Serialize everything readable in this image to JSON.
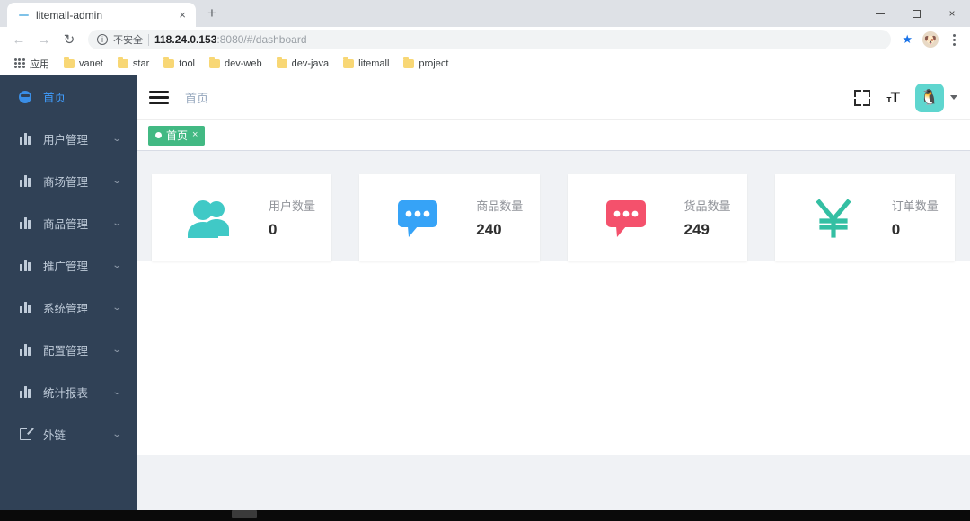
{
  "browser": {
    "tab": {
      "title": "litemall-admin",
      "favicon": "dash-favicon",
      "close": "×"
    },
    "new_tab_label": "+",
    "window_controls": {
      "minimize": "minimize-icon",
      "maximize": "maximize-icon",
      "close": "×"
    },
    "nav": {
      "back": "←",
      "forward": "→",
      "reload": "↻"
    },
    "omnibox": {
      "security_icon": "ⓘ",
      "security_label": "不安全",
      "url_host": "118.24.0.153",
      "url_rest": ":8080/#/dashboard",
      "star_icon": "★",
      "profile_icon": "🐶",
      "menu_icon": "kebab-menu-icon"
    },
    "bookmarks": [
      {
        "label": "应用",
        "icon": "apps-grid-icon"
      },
      {
        "label": "vanet",
        "icon": "folder-icon"
      },
      {
        "label": "star",
        "icon": "folder-icon"
      },
      {
        "label": "tool",
        "icon": "folder-icon"
      },
      {
        "label": "dev-web",
        "icon": "folder-icon"
      },
      {
        "label": "dev-java",
        "icon": "folder-icon"
      },
      {
        "label": "litemall",
        "icon": "folder-icon"
      },
      {
        "label": "project",
        "icon": "folder-icon"
      }
    ]
  },
  "sidebar": {
    "background": "#304156",
    "active_color": "#409eff",
    "items": [
      {
        "label": "首页",
        "icon": "dashboard-icon",
        "active": true,
        "expandable": false
      },
      {
        "label": "用户管理",
        "icon": "chart-bars-icon",
        "active": false,
        "expandable": true
      },
      {
        "label": "商场管理",
        "icon": "chart-bars-icon",
        "active": false,
        "expandable": true
      },
      {
        "label": "商品管理",
        "icon": "chart-bars-icon",
        "active": false,
        "expandable": true
      },
      {
        "label": "推广管理",
        "icon": "chart-bars-icon",
        "active": false,
        "expandable": true
      },
      {
        "label": "系统管理",
        "icon": "chart-bars-icon",
        "active": false,
        "expandable": true
      },
      {
        "label": "配置管理",
        "icon": "chart-bars-icon",
        "active": false,
        "expandable": true
      },
      {
        "label": "统计报表",
        "icon": "chart-bars-icon",
        "active": false,
        "expandable": true
      },
      {
        "label": "外链",
        "icon": "external-link-icon",
        "active": false,
        "expandable": true
      }
    ],
    "chevron": "⌄"
  },
  "navbar": {
    "hamburger": "hamburger-icon",
    "breadcrumb": "首页",
    "fullscreen_icon": "fullscreen-icon",
    "fontsize_icon_small": "ᴛ",
    "fontsize_icon_big": "T",
    "avatar_emoji": "🐧",
    "caret": "caret-down-icon"
  },
  "tags_view": {
    "tags": [
      {
        "label": "首页",
        "active": true,
        "close": "×",
        "color": "#42b983"
      }
    ]
  },
  "dashboard": {
    "cards": [
      {
        "title": "用户数量",
        "value": "0",
        "icon": "people-icon",
        "color": "#40c9c6"
      },
      {
        "title": "商品数量",
        "value": "240",
        "icon": "message-icon",
        "color": "#36a3f7"
      },
      {
        "title": "货品数量",
        "value": "249",
        "icon": "message-icon",
        "color": "#f4516c"
      },
      {
        "title": "订单数量",
        "value": "0",
        "icon": "yen-money-icon",
        "color": "#34bfa3"
      }
    ]
  },
  "taskbar": {
    "time": ""
  }
}
